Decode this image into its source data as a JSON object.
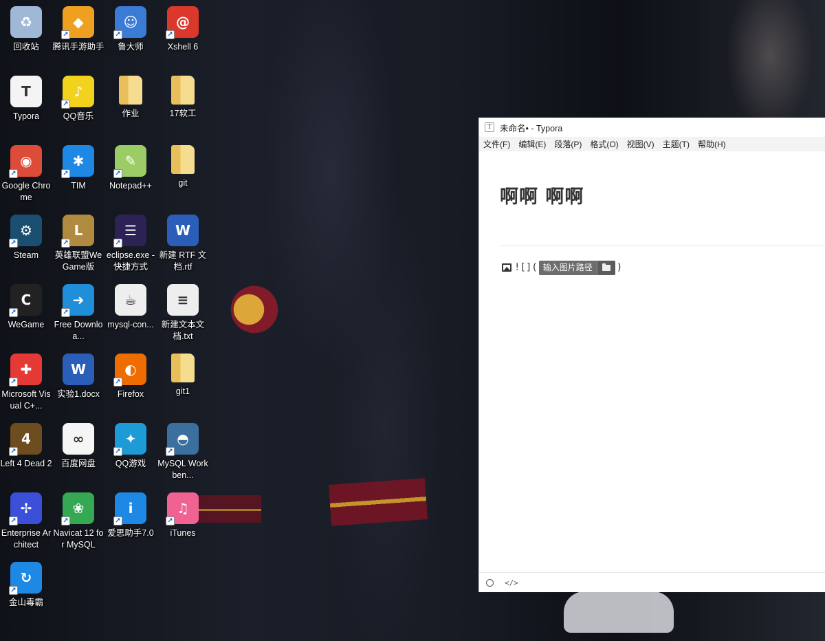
{
  "desktop": {
    "icons": [
      {
        "label": "回收站",
        "icon": "recycle-bin-icon",
        "color": "#9fb8d6",
        "glyph": "♻",
        "shortcut": false
      },
      {
        "label": "腾讯手游助手",
        "icon": "tencent-mobile-games-icon",
        "color": "#f0a020",
        "glyph": "◆",
        "shortcut": true
      },
      {
        "label": "鲁大师",
        "icon": "ludashi-icon",
        "color": "#3a7bd5",
        "glyph": "☺",
        "shortcut": true
      },
      {
        "label": "Xshell 6",
        "icon": "xshell-icon",
        "color": "#d9382b",
        "glyph": "@",
        "shortcut": true
      },
      {
        "label": "Typora",
        "icon": "typora-icon",
        "color": "#f4f4f4",
        "glyph": "T",
        "shortcut": false
      },
      {
        "label": "QQ音乐",
        "icon": "qq-music-icon",
        "color": "#f2d21c",
        "glyph": "♪",
        "shortcut": true
      },
      {
        "label": "作业",
        "icon": "folder-icon",
        "color": "#f3d27a",
        "glyph": "",
        "shortcut": false
      },
      {
        "label": "17软工",
        "icon": "folder-icon",
        "color": "#f3d27a",
        "glyph": "",
        "shortcut": false
      },
      {
        "label": "Google Chrome",
        "icon": "chrome-icon",
        "color": "#dd4b39",
        "glyph": "◉",
        "shortcut": true
      },
      {
        "label": "TIM",
        "icon": "tim-icon",
        "color": "#1e88e5",
        "glyph": "✱",
        "shortcut": true
      },
      {
        "label": "Notepad++",
        "icon": "notepad-plus-plus-icon",
        "color": "#9ccc65",
        "glyph": "✎",
        "shortcut": true
      },
      {
        "label": "git",
        "icon": "folder-icon",
        "color": "#f3d27a",
        "glyph": "",
        "shortcut": false
      },
      {
        "label": "Steam",
        "icon": "steam-icon",
        "color": "#1b4f72",
        "glyph": "⚙",
        "shortcut": true
      },
      {
        "label": "英雄联盟WeGame版",
        "icon": "league-of-legends-icon",
        "color": "#b08a3e",
        "glyph": "L",
        "shortcut": true
      },
      {
        "label": "eclipse.exe - 快捷方式",
        "icon": "eclipse-icon",
        "color": "#2c2255",
        "glyph": "☰",
        "shortcut": true
      },
      {
        "label": "新建 RTF 文档.rtf",
        "icon": "word-document-icon",
        "color": "#2b5eb8",
        "glyph": "W",
        "shortcut": false
      },
      {
        "label": "WeGame",
        "icon": "wegame-icon",
        "color": "#222222",
        "glyph": "C",
        "shortcut": true
      },
      {
        "label": "Free Downloa...",
        "icon": "free-download-manager-icon",
        "color": "#1e8fd8",
        "glyph": "➜",
        "shortcut": true
      },
      {
        "label": "mysql-con...",
        "icon": "java-icon",
        "color": "#eeeeee",
        "glyph": "☕",
        "shortcut": false
      },
      {
        "label": "新建文本文档.txt",
        "icon": "text-document-icon",
        "color": "#eeeeee",
        "glyph": "≡",
        "shortcut": false
      },
      {
        "label": "Microsoft Visual C+...",
        "icon": "visual-cpp-icon",
        "color": "#e53935",
        "glyph": "✚",
        "shortcut": true
      },
      {
        "label": "实验1.docx",
        "icon": "word-document-icon",
        "color": "#2b5eb8",
        "glyph": "W",
        "shortcut": false
      },
      {
        "label": "Firefox",
        "icon": "firefox-icon",
        "color": "#ef6c00",
        "glyph": "◐",
        "shortcut": true
      },
      {
        "label": "git1",
        "icon": "folder-icon",
        "color": "#f3d27a",
        "glyph": "",
        "shortcut": false
      },
      {
        "label": "Left 4 Dead 2",
        "icon": "left-4-dead-2-icon",
        "color": "#6d4c1f",
        "glyph": "4",
        "shortcut": true
      },
      {
        "label": "百度网盘",
        "icon": "baidu-netdisk-icon",
        "color": "#f5f5f5",
        "glyph": "∞",
        "shortcut": false
      },
      {
        "label": "QQ游戏",
        "icon": "qq-game-icon",
        "color": "#1d9bd7",
        "glyph": "✦",
        "shortcut": true
      },
      {
        "label": "MySQL Workben...",
        "icon": "mysql-workbench-icon",
        "color": "#3a6f9e",
        "glyph": "◓",
        "shortcut": true
      },
      {
        "label": "Enterprise Architect",
        "icon": "enterprise-architect-icon",
        "color": "#3b4fd8",
        "glyph": "✢",
        "shortcut": true
      },
      {
        "label": "Navicat 12 for MySQL",
        "icon": "navicat-icon",
        "color": "#34a853",
        "glyph": "❀",
        "shortcut": true
      },
      {
        "label": "爱思助手7.0",
        "icon": "i4-assistant-icon",
        "color": "#1e88e5",
        "glyph": "i",
        "shortcut": true
      },
      {
        "label": "iTunes",
        "icon": "itunes-icon",
        "color": "#f06292",
        "glyph": "♫",
        "shortcut": true
      },
      {
        "label": "金山毒霸",
        "icon": "kingsoft-antivirus-icon",
        "color": "#1e88e5",
        "glyph": "↻",
        "shortcut": true
      }
    ]
  },
  "typora": {
    "title": "未命名• - Typora",
    "app_icon_letter": "T",
    "menu": [
      "文件(F)",
      "编辑(E)",
      "段落(P)",
      "格式(O)",
      "视图(V)",
      "主题(T)",
      "帮助(H)"
    ],
    "heading": "啊啊 啊啊",
    "image_syntax_prefix": "![](",
    "image_syntax_suffix": ")",
    "path_input_placeholder": "输入图片路径",
    "status_code_toggle": "</>"
  }
}
